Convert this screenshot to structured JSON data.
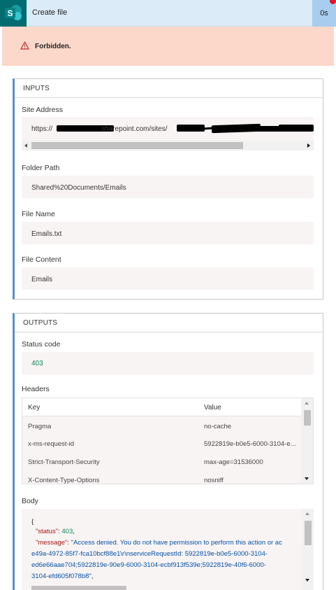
{
  "header": {
    "title": "Create file",
    "duration": "0s"
  },
  "error": {
    "message": "Forbidden."
  },
  "inputs": {
    "heading": "INPUTS",
    "site_address": {
      "label": "Site Address",
      "value_prefix": "https://",
      "value_middle": "sharepoint.com/sites/"
    },
    "folder_path": {
      "label": "Folder Path",
      "value": "Shared%20Documents/Emails"
    },
    "file_name": {
      "label": "File Name",
      "value": "Emails.txt"
    },
    "file_content": {
      "label": "File Content",
      "value": "Emails"
    }
  },
  "outputs": {
    "heading": "OUTPUTS",
    "status_code": {
      "label": "Status code",
      "value": "403"
    },
    "headers": {
      "label": "Headers",
      "columns": [
        "Key",
        "Value"
      ],
      "rows": [
        [
          "Pragma",
          "no-cache"
        ],
        [
          "x-ms-request-id",
          "5922819e-b0e5-6000-3104-e..."
        ],
        [
          "Strict-Transport-Security",
          "max-age=31536000"
        ],
        [
          "X-Content-Type-Options",
          "nosniff"
        ]
      ]
    },
    "body": {
      "label": "Body",
      "open_brace": "{",
      "status_key": "\"status\"",
      "status_value": "403",
      "message_key": "\"message\"",
      "message_line1": "\"Access denied. You do not have permission to perform this action or ac",
      "message_line2": "e49a-4972-85f7-fca10bcf88e1\\r\\nserviceRequestId: 5922819e-b0e5-6000-3104-",
      "message_line3": "ed6e66aae704;5922819e-90e9-6000-3104-ecbf913f539e;5922819e-40f6-6000-",
      "message_line4": "3104-efd605f078b8\""
    }
  },
  "colors": {
    "header_bg": "#dcebf8",
    "duration_bg": "#a8cdee",
    "error_bg": "#fcd8ca",
    "card_accent": "#5b8fcb",
    "status_value": "#098658",
    "json_key": "#a31515",
    "json_string": "#0451a5"
  },
  "icons": [
    "sharepoint-logo-icon",
    "warning-icon",
    "scroll-left-icon",
    "scroll-right-icon",
    "scroll-up-icon",
    "scroll-down-icon"
  ]
}
